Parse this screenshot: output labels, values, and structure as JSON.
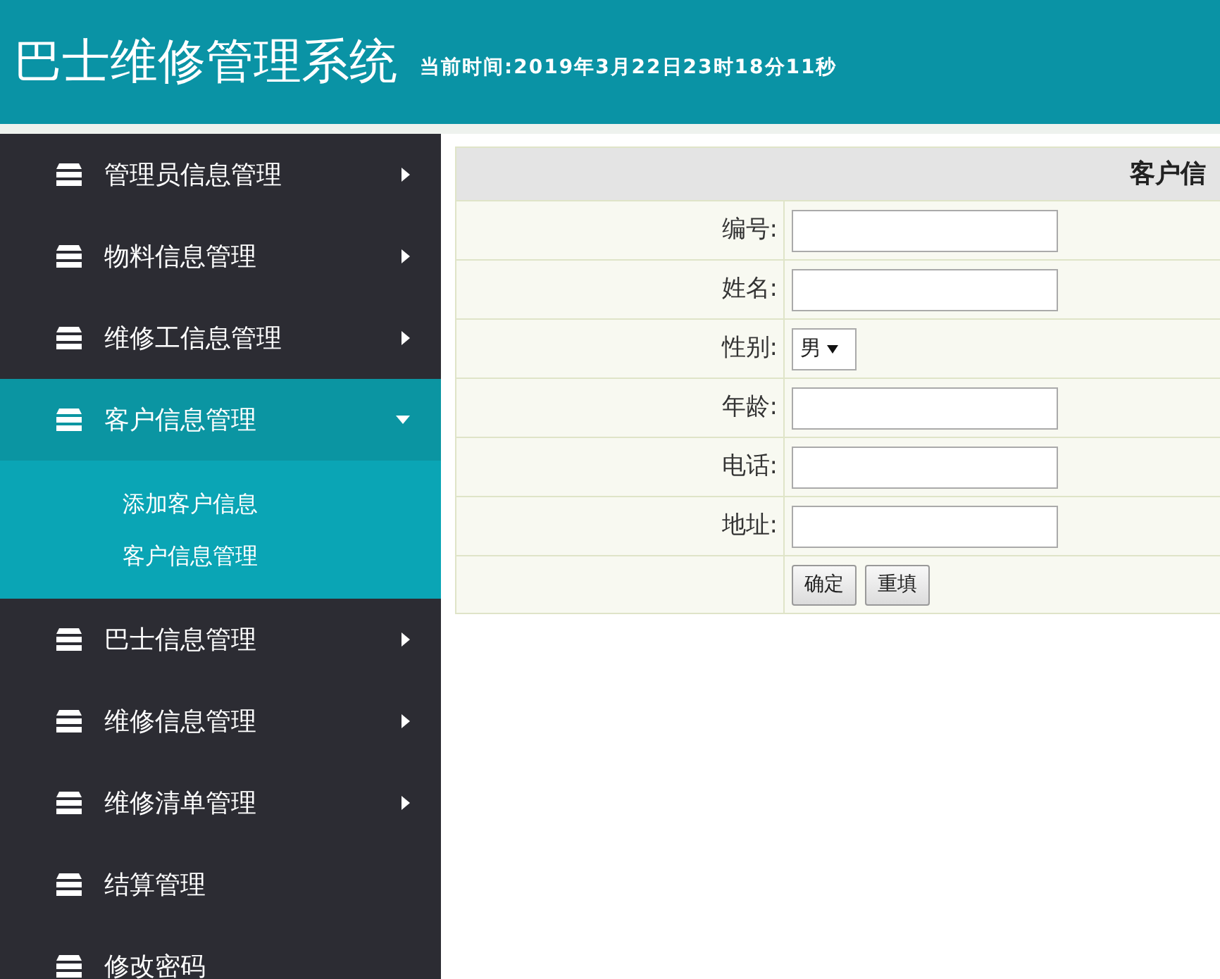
{
  "header": {
    "title": "巴士维修管理系统",
    "time": "当前时间:2019年3月22日23时18分11秒"
  },
  "sidebar": {
    "items": [
      {
        "label": "管理员信息管理",
        "kind": "group",
        "expanded": false
      },
      {
        "label": "物料信息管理",
        "kind": "group",
        "expanded": false
      },
      {
        "label": "维修工信息管理",
        "kind": "group",
        "expanded": false
      },
      {
        "label": "客户信息管理",
        "kind": "group",
        "expanded": true,
        "children": [
          {
            "label": "添加客户信息"
          },
          {
            "label": "客户信息管理"
          }
        ]
      },
      {
        "label": "巴士信息管理",
        "kind": "group",
        "expanded": false
      },
      {
        "label": "维修信息管理",
        "kind": "group",
        "expanded": false
      },
      {
        "label": "维修清单管理",
        "kind": "group",
        "expanded": false
      },
      {
        "label": "结算管理",
        "kind": "link"
      },
      {
        "label": "修改密码",
        "kind": "link"
      }
    ]
  },
  "form": {
    "title": "客户信",
    "fields": [
      {
        "label": "编号:",
        "kind": "text"
      },
      {
        "label": "姓名:",
        "kind": "text"
      },
      {
        "label": "性别:",
        "kind": "select",
        "value": "男"
      },
      {
        "label": "年龄:",
        "kind": "text"
      },
      {
        "label": "电话:",
        "kind": "text"
      },
      {
        "label": "地址:",
        "kind": "text"
      }
    ],
    "buttons": [
      "确定",
      "重填"
    ]
  }
}
